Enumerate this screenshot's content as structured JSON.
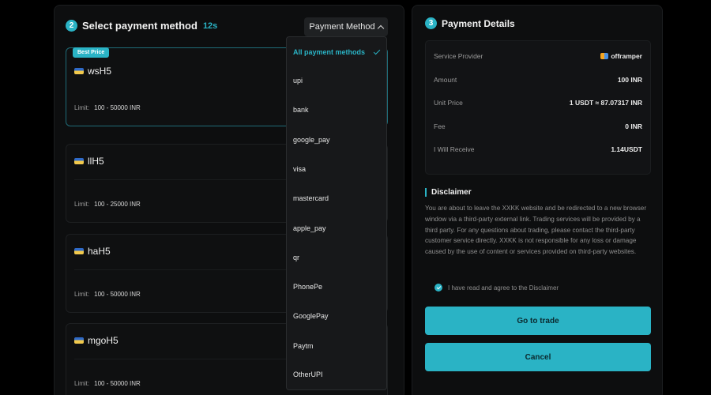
{
  "select_section": {
    "step": "2",
    "title": "Select payment method",
    "timer": "12s",
    "filter_label": "Payment Method"
  },
  "providers": [
    {
      "badge": "Best Price",
      "name": "wsH5",
      "limit_label": "Limit:",
      "limit": "100 - 50000 INR"
    },
    {
      "badge": "",
      "name": "llH5",
      "limit_label": "Limit:",
      "limit": "100 - 25000 INR"
    },
    {
      "badge": "",
      "name": "haH5",
      "limit_label": "Limit:",
      "limit": "100 - 50000 INR"
    },
    {
      "badge": "",
      "name": "mgoH5",
      "limit_label": "Limit:",
      "limit": "100 - 50000 INR"
    }
  ],
  "dropdown": {
    "items": [
      "All payment methods",
      "upi",
      "bank",
      "google_pay",
      "visa",
      "mastercard",
      "apple_pay",
      "qr",
      "PhonePe",
      "GooglePay",
      "Paytm",
      "OtherUPI"
    ],
    "selected": "All payment methods"
  },
  "details": {
    "step": "3",
    "title": "Payment Details",
    "rows": [
      {
        "label": "Service Provider",
        "value": "offramper"
      },
      {
        "label": "Amount",
        "value": "100 INR"
      },
      {
        "label": "Unit Price",
        "value": "1 USDT ≈ 87.07317 INR"
      },
      {
        "label": "Fee",
        "value": "0 INR"
      },
      {
        "label": "I Will Receive",
        "value": "1.14USDT"
      }
    ]
  },
  "disclaimer": {
    "title": "Disclaimer",
    "text": "You are about to leave the XXKK website and be redirected to a new browser window via a third-party external link. Trading services will be provided by a third party. For any questions about trading, please contact the third-party customer service directly. XXKK is not responsible for any loss or damage caused by the use of content or services provided on third-party websites.",
    "agree": "I have read and agree to the Disclaimer"
  },
  "buttons": {
    "trade": "Go to trade",
    "cancel": "Cancel"
  },
  "colors": {
    "accent": "#2ab3c5",
    "background": "#000000",
    "panel": "#0d0e0f"
  }
}
